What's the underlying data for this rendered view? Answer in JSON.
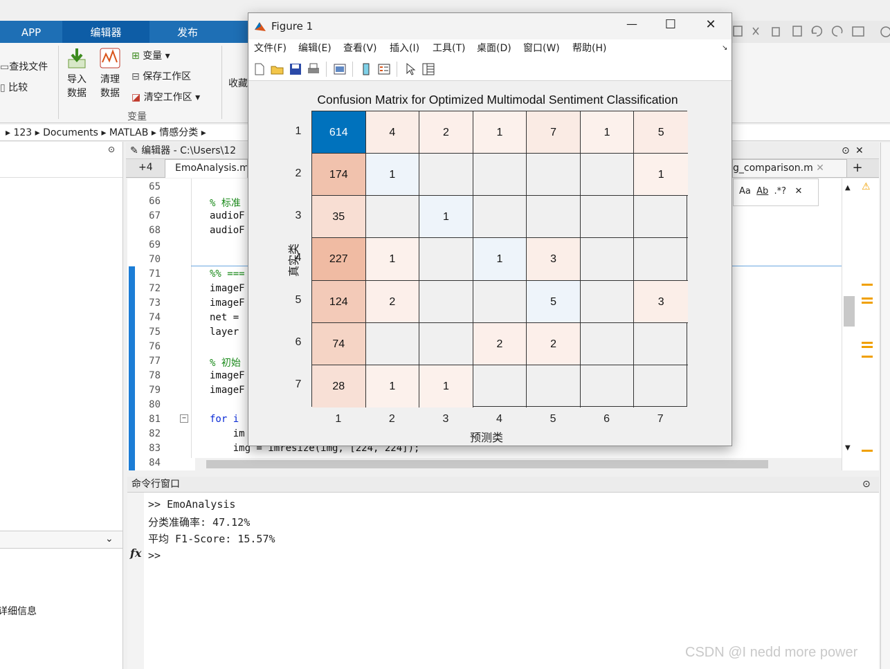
{
  "ribbon": {
    "tabs": [
      "APP",
      "编辑器",
      "发布"
    ],
    "items": {
      "find_files": "查找文件",
      "compare": "比较",
      "import_data": [
        "导入",
        "数据"
      ],
      "clean_data": [
        "清理",
        "数据"
      ],
      "variable": "变量",
      "save_workspace": "保存工作区",
      "clear_workspace": "清空工作区",
      "favorites": "收藏",
      "group_variable": "变量"
    }
  },
  "address": [
    "123",
    "Documents",
    "MATLAB",
    "情感分类"
  ],
  "editor": {
    "header": "编辑器 - C:\\Users\\12",
    "tab_plus": "+4",
    "tab_active": "EmoAnalysis.m",
    "tab_right": "g_comparison.m",
    "find_opts": [
      "Aa",
      "Ab",
      ".*?"
    ],
    "lines": [
      {
        "n": "65",
        "code": ""
      },
      {
        "n": "66",
        "code": "% 标准",
        "cls": "cmt"
      },
      {
        "n": "67",
        "code": "audioF"
      },
      {
        "n": "68",
        "code": "audioF"
      },
      {
        "n": "69",
        "code": ""
      },
      {
        "n": "70",
        "code": ""
      },
      {
        "n": "71",
        "code": "%% ===",
        "cls": "cmt"
      },
      {
        "n": "72",
        "code": "imageF"
      },
      {
        "n": "73",
        "code": "imageF"
      },
      {
        "n": "74",
        "code": "net ="
      },
      {
        "n": "75",
        "code": "layer"
      },
      {
        "n": "76",
        "code": ""
      },
      {
        "n": "77",
        "code": "% 初始",
        "cls": "cmt"
      },
      {
        "n": "78",
        "code": "imageF"
      },
      {
        "n": "79",
        "code": "imageF"
      },
      {
        "n": "80",
        "code": ""
      },
      {
        "n": "81",
        "code": "for i",
        "cls": "kw"
      },
      {
        "n": "82",
        "code": "    im"
      },
      {
        "n": "83",
        "code": "    img = imresize(img, [224, 224]);"
      },
      {
        "n": "84",
        "code": ""
      }
    ]
  },
  "command_window": {
    "title": "命令行窗口",
    "lines": [
      ">> EmoAnalysis",
      "分类准确率: 47.12%",
      "平均 F1-Score: 15.57%"
    ],
    "prompt": ">>",
    "fx": "fx"
  },
  "left_pane": {
    "details": "详细信息"
  },
  "figure": {
    "title": "Figure 1",
    "menu": [
      "文件(F)",
      "编辑(E)",
      "查看(V)",
      "插入(I)",
      "工具(T)",
      "桌面(D)",
      "窗口(W)",
      "帮助(H)"
    ],
    "controls": {
      "minimize": "—",
      "maximize": "☐",
      "close": "✕"
    }
  },
  "chart_data": {
    "type": "heatmap",
    "title": "Confusion Matrix for Optimized Multimodal Sentiment Classification",
    "xlabel": "预测类",
    "ylabel": "真实类",
    "row_labels": [
      "1",
      "2",
      "3",
      "4",
      "5",
      "6",
      "7"
    ],
    "col_labels": [
      "1",
      "2",
      "3",
      "4",
      "5",
      "6",
      "7"
    ],
    "matrix": [
      [
        614,
        4,
        2,
        1,
        7,
        1,
        5
      ],
      [
        174,
        1,
        null,
        null,
        null,
        null,
        1
      ],
      [
        35,
        null,
        1,
        null,
        null,
        null,
        null
      ],
      [
        227,
        1,
        null,
        1,
        3,
        null,
        null
      ],
      [
        124,
        2,
        null,
        null,
        5,
        null,
        3
      ],
      [
        74,
        null,
        null,
        2,
        2,
        null,
        null
      ],
      [
        28,
        1,
        1,
        null,
        null,
        null,
        null
      ]
    ],
    "colors": {
      "diag_strong": "#0072bd",
      "diag_light": "#eef4fa",
      "off_diag": "#d9541a"
    }
  },
  "watermark": "CSDN @I nedd more power"
}
